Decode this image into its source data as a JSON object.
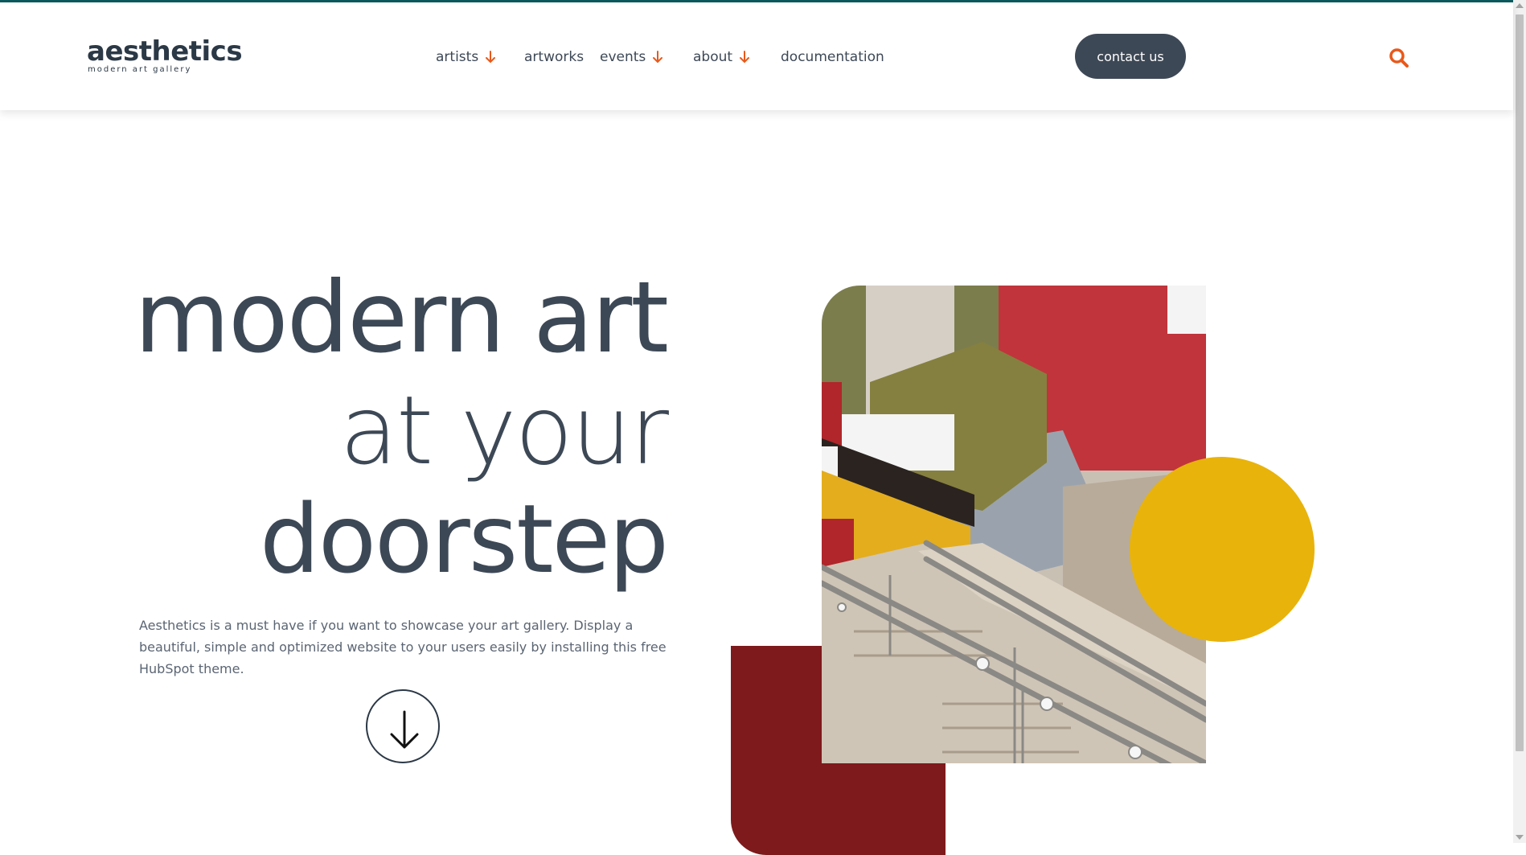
{
  "brand": {
    "name": "aesthetics",
    "tagline": "modern art gallery"
  },
  "nav": {
    "items": [
      {
        "label": "artists",
        "has_dropdown": true
      },
      {
        "label": "artworks",
        "has_dropdown": false
      },
      {
        "label": "events",
        "has_dropdown": true
      },
      {
        "label": "about",
        "has_dropdown": true
      },
      {
        "label": "documentation",
        "has_dropdown": false
      }
    ],
    "contact_label": "contact us",
    "search_icon": "search-icon"
  },
  "hero": {
    "headline_line1": "modern art",
    "headline_line2": "at your",
    "headline_line3": "doorstep",
    "description": "Aesthetics is a must have if you want to showcase your art gallery. Display a beautiful, simple and optimized website to your users easily by installing this free HubSpot theme.",
    "scroll_icon": "arrow-down-icon"
  },
  "colors": {
    "accent_orange": "#e8591a",
    "dark_slate": "#3d4856",
    "top_border_teal": "#0c5a5e",
    "yellow": "#e8b30b",
    "maroon": "#7e1a1c"
  }
}
